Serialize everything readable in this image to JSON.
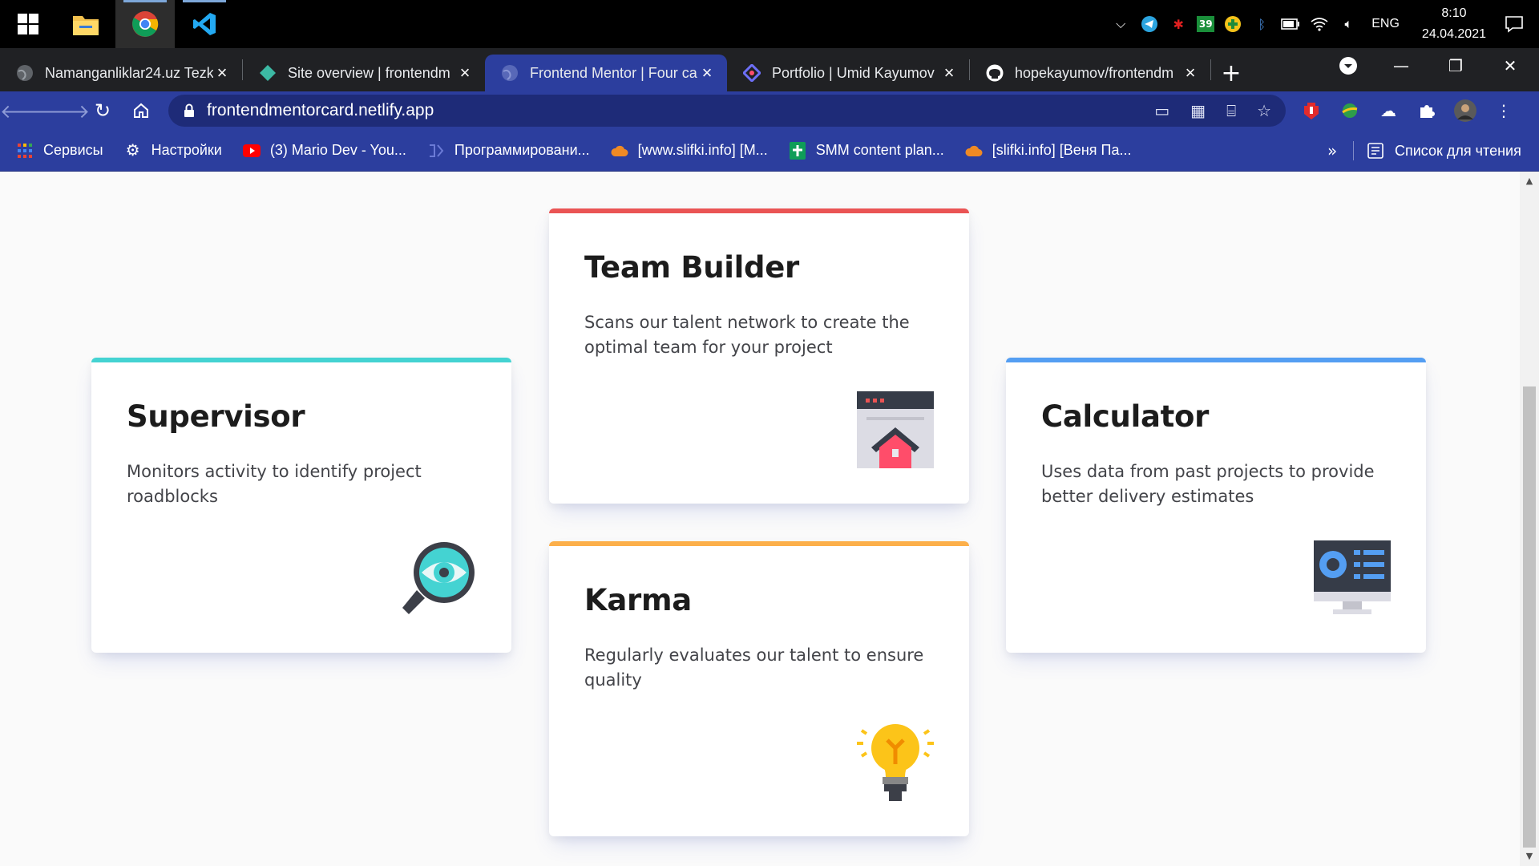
{
  "taskbar": {
    "apps": [
      {
        "name": "file-explorer"
      },
      {
        "name": "chrome"
      },
      {
        "name": "vscode"
      }
    ],
    "tray": {
      "badge_count": "39",
      "language": "ENG",
      "time": "8:10",
      "date": "24.04.2021"
    }
  },
  "tabs": [
    {
      "title": "Namanganliklar24.uz Tezk",
      "active": false
    },
    {
      "title": "Site overview | frontendm",
      "active": false
    },
    {
      "title": "Frontend Mentor | Four ca",
      "active": true
    },
    {
      "title": "Portfolio | Umid Kayumov",
      "active": false
    },
    {
      "title": "hopekayumov/frontendm",
      "active": false
    }
  ],
  "toolbar": {
    "url": "frontendmentorcard.netlify.app"
  },
  "bookmarks": [
    {
      "label": "Сервисы",
      "icon": "apps-grid-icon"
    },
    {
      "label": "Настройки",
      "icon": "gear-icon"
    },
    {
      "label": "(3) Mario Dev - You...",
      "icon": "youtube-icon"
    },
    {
      "label": "Программировани...",
      "icon": "code-icon"
    },
    {
      "label": "[www.slifki.info] [M...",
      "icon": "cloud-icon"
    },
    {
      "label": "SMM content plan...",
      "icon": "sheets-icon"
    },
    {
      "label": "[slifki.info] [Веня Па...",
      "icon": "cloud-icon"
    }
  ],
  "bookmarks_more": "»",
  "reading_list": "Список для чтения",
  "cards": {
    "supervisor": {
      "title": "Supervisor",
      "text": "Monitors activity to identify project roadblocks",
      "accent": "#44d3d2"
    },
    "team": {
      "title": "Team Builder",
      "text": "Scans our talent network to create the optimal team for your project",
      "accent": "#ea5454"
    },
    "karma": {
      "title": "Karma",
      "text": "Regularly evaluates our talent to ensure quality",
      "accent": "#fcaf4a"
    },
    "calculator": {
      "title": "Calculator",
      "text": "Uses data from past projects to provide better delivery estimates",
      "accent": "#549ef2"
    }
  }
}
